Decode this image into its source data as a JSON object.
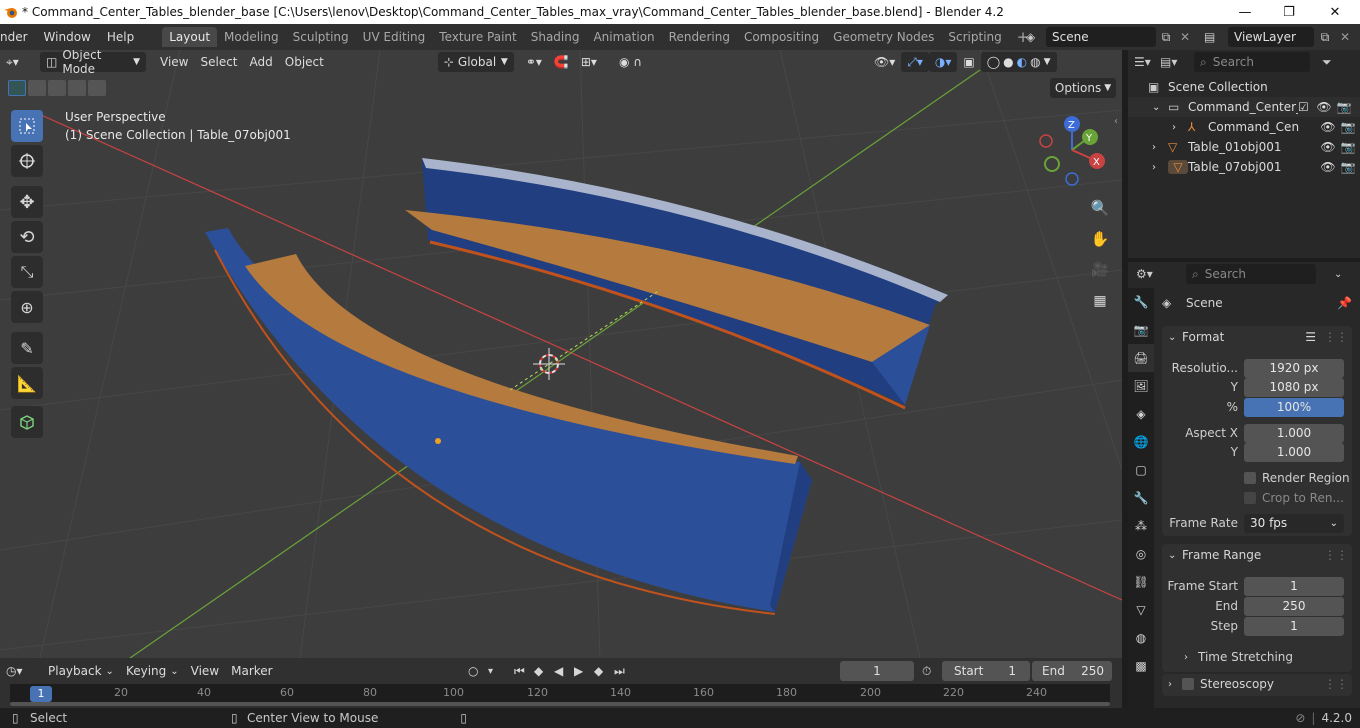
{
  "window": {
    "title": "* Command_Center_Tables_blender_base [C:\\Users\\lenov\\Desktop\\Command_Center_Tables_max_vray\\Command_Center_Tables_blender_base.blend] - Blender 4.2",
    "minimize": "—",
    "maximize": "❐",
    "close": "✕"
  },
  "menu": [
    "nder",
    "Window",
    "Help"
  ],
  "workspaces": [
    "Layout",
    "Modeling",
    "Sculpting",
    "UV Editing",
    "Texture Paint",
    "Shading",
    "Animation",
    "Rendering",
    "Compositing",
    "Geometry Nodes",
    "Scripting"
  ],
  "active_workspace": "Layout",
  "scene_field": "Scene",
  "viewlayer_field": "ViewLayer",
  "viewport": {
    "mode": "Object Mode",
    "menus": [
      "View",
      "Select",
      "Add",
      "Object"
    ],
    "orientation": "Global",
    "options_label": "Options",
    "overlay_line1": "User Perspective",
    "overlay_line2": "(1) Scene Collection | Table_07obj001"
  },
  "outliner": {
    "search_placeholder": "Search",
    "rows": [
      {
        "label": "Scene Collection",
        "indent": 0
      },
      {
        "label": "Command_Center_",
        "indent": 1
      },
      {
        "label": "Command_Cen",
        "indent": 2
      },
      {
        "label": "Table_01obj001",
        "indent": 1
      },
      {
        "label": "Table_07obj001",
        "indent": 1
      }
    ]
  },
  "properties": {
    "search_placeholder": "Search",
    "context": "Scene",
    "format": {
      "title": "Format",
      "resolution_label": "Resolutio...",
      "resolution_x": "1920 px",
      "y_label": "Y",
      "resolution_y": "1080 px",
      "percent_label": "%",
      "percent": "100%",
      "aspect_label": "Aspect X",
      "aspect_x": "1.000",
      "aspect_y_label": "Y",
      "aspect_y": "1.000",
      "render_region": "Render Region",
      "crop": "Crop to Ren...",
      "frame_rate_label": "Frame Rate",
      "frame_rate": "30 fps"
    },
    "frame_range": {
      "title": "Frame Range",
      "start_label": "Frame Start",
      "start": "1",
      "end_label": "End",
      "end": "250",
      "step_label": "Step",
      "step": "1"
    },
    "time_stretching": "Time Stretching",
    "stereoscopy": "Stereoscopy"
  },
  "timeline": {
    "menus": [
      "Playback",
      "Keying",
      "View",
      "Marker"
    ],
    "current_frame": "1",
    "start_label": "Start",
    "start": "1",
    "end_label": "End",
    "end": "250",
    "ticks": [
      "1",
      "20",
      "40",
      "60",
      "80",
      "100",
      "120",
      "140",
      "160",
      "180",
      "200",
      "220",
      "240"
    ]
  },
  "status": {
    "select": "Select",
    "center_view": "Center View to Mouse",
    "version": "4.2.0"
  },
  "colors": {
    "accent": "#4772b3",
    "table_blue": "#2c4f99",
    "table_wood": "#b57a3e",
    "axis_red": "#c94343",
    "axis_green": "#6aa338"
  }
}
